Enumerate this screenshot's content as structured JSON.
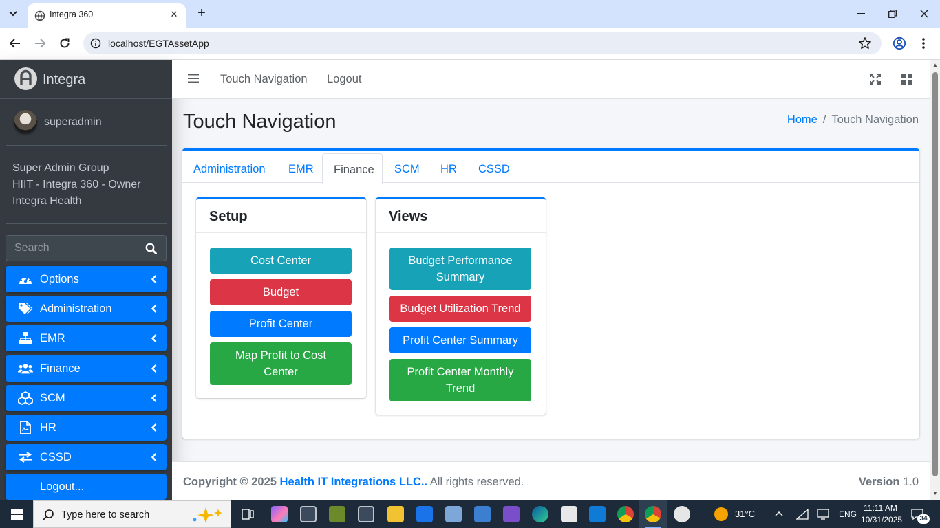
{
  "browser": {
    "tab_title": "Integra 360",
    "url": "localhost/EGTAssetApp"
  },
  "sidebar": {
    "brand": "Integra",
    "user_name": "superadmin",
    "group_lines": [
      "Super Admin Group",
      "HIIT - Integra 360 - Owner",
      "Integra Health"
    ],
    "search_placeholder": "Search",
    "menu": [
      {
        "label": "Options",
        "icon": "dashboard-icon"
      },
      {
        "label": "Administration",
        "icon": "tags-icon"
      },
      {
        "label": "EMR",
        "icon": "sitemap-icon"
      },
      {
        "label": "Finance",
        "icon": "users-icon"
      },
      {
        "label": "SCM",
        "icon": "cubes-icon"
      },
      {
        "label": "HR",
        "icon": "file-icon"
      },
      {
        "label": "CSSD",
        "icon": "exchange-icon"
      },
      {
        "label": "Logout...",
        "icon": ""
      }
    ]
  },
  "header": {
    "nav_links": [
      "Touch Navigation",
      "Logout"
    ]
  },
  "page": {
    "title": "Touch Navigation",
    "breadcrumb": {
      "home": "Home",
      "separator": "/",
      "active": "Touch Navigation"
    }
  },
  "tabs": {
    "items": [
      "Administration",
      "EMR",
      "Finance",
      "SCM",
      "HR",
      "CSSD"
    ],
    "active": "Finance"
  },
  "setup": {
    "title": "Setup",
    "buttons": [
      "Cost Center",
      "Budget",
      "Profit Center",
      "Map Profit to Cost Center"
    ]
  },
  "views": {
    "title": "Views",
    "buttons": [
      "Budget Performance Summary",
      "Budget Utilization Trend",
      "Profit Center Summary",
      "Profit Center Monthly Trend"
    ]
  },
  "footer": {
    "copyright_prefix": "Copyright © 2025",
    "company": "Health IT Integrations LLC..",
    "rights": "All rights reserved.",
    "version_label": "Version",
    "version": "1.0"
  },
  "taskbar": {
    "search_placeholder": "Type here to search",
    "weather": "31°C",
    "language": "ENG",
    "time": "11:11 AM",
    "date": "10/31/2025",
    "notification_count": "34"
  },
  "colors": {
    "primary": "#007bff",
    "info": "#17a2b8",
    "danger": "#dc3545",
    "success": "#28a745",
    "sidebar_bg": "#343a40"
  }
}
